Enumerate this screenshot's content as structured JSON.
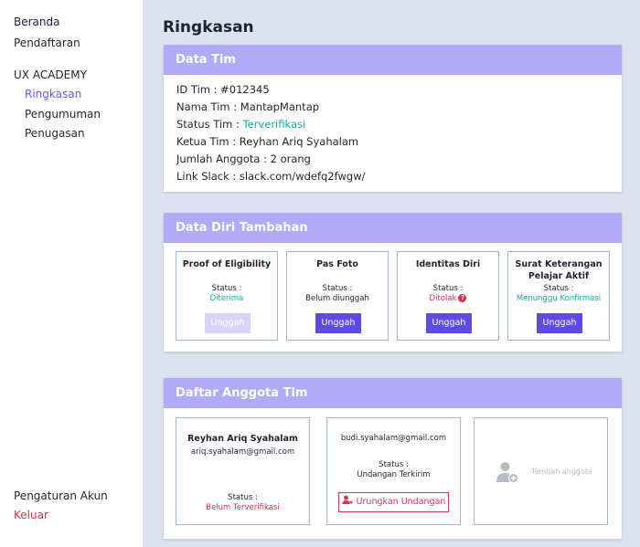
{
  "sidebar": {
    "items": [
      {
        "label": "Beranda"
      },
      {
        "label": "Pendaftaran"
      }
    ],
    "section": "UX ACADEMY",
    "sub_items": [
      {
        "label": "Ringkasan"
      },
      {
        "label": "Pengumuman"
      },
      {
        "label": "Penugasan"
      }
    ],
    "settings": "Pengaturan Akun",
    "logout": "Keluar"
  },
  "page": {
    "title": "Ringkasan"
  },
  "team": {
    "heading": "Data Tim",
    "id_line": "ID Tim : #012345",
    "name_line": "Nama Tim : MantapMantap",
    "status_label": "Status Tim : ",
    "status_value": "Terverifikasi",
    "leader_line": "Ketua Tim : Reyhan Ariq Syahalam",
    "members_line": "Jumlah Anggota : 2 orang",
    "slack_line": "Link Slack : slack.com/wdefq2fwgw/"
  },
  "documents": {
    "heading": "Data Diri Tambahan",
    "status_label": "Status :",
    "upload_label": "Unggah",
    "items": [
      {
        "title": "Proof of Eligibility",
        "status": "Diterima"
      },
      {
        "title": "Pas Foto",
        "status": "Belum diunggah"
      },
      {
        "title": "Identitas Diri",
        "status": "Ditolak"
      },
      {
        "title": "Surat Keterangan Pelajar Aktif",
        "status": "Menunggu Konfirmasi"
      }
    ]
  },
  "members": {
    "heading": "Daftar Anggota Tim",
    "status_label": "Status :",
    "leader": {
      "name": "Reyhan Ariq Syahalam",
      "email": "ariq.syahalam@gmail.com",
      "status": "Belum Terverifikasi"
    },
    "invited": {
      "email": "budi.syahalam@gmail.com",
      "status": "Undangan Terkirim",
      "cancel_label": "Urungkan Undangan"
    },
    "add_label": "Tambah anggota"
  },
  "colors": {
    "accent": "#5d4cdf",
    "header": "#b2a9f8",
    "verified": "#1aa89a",
    "danger": "#d6324a"
  }
}
